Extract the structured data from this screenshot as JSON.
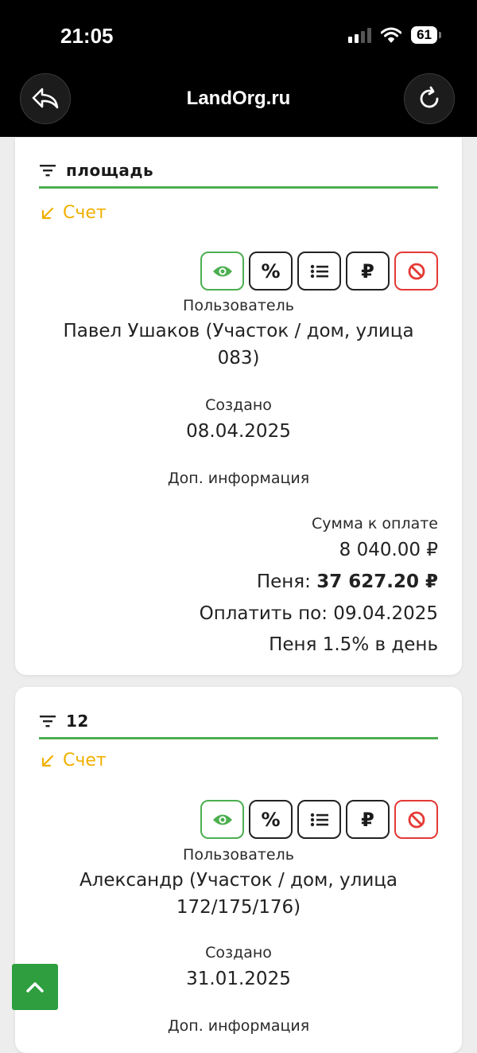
{
  "status_bar": {
    "time": "21:05",
    "battery": "61"
  },
  "header": {
    "title": "LandOrg.ru",
    "back_icon": "back-arrow-icon",
    "reload_icon": "reload-icon"
  },
  "invoices": [
    {
      "header_label": "площадь",
      "type_label": "Счет",
      "user_label": "Пользователь",
      "user_line1": "Павел Ушаков (Участок / дом, улица",
      "user_line2": "083)",
      "created_label": "Создано",
      "created_value": "08.04.2025",
      "extra_info_label": "Доп. информация",
      "amount_label": "Сумма к оплате",
      "amount_value": "8 040.00 ₽",
      "penalty_label": "Пеня:",
      "penalty_value": "37 627.20 ₽",
      "due_text": "Оплатить по: 09.04.2025",
      "penalty_rate": "Пеня 1.5% в день"
    },
    {
      "header_label": "12",
      "type_label": "Счет",
      "user_label": "Пользователь",
      "user_line1": "Александр (Участок / дом, улица",
      "user_line2": "172/175/176)",
      "created_label": "Создано",
      "created_value": "31.01.2025",
      "extra_info_label": "Доп. информация"
    }
  ],
  "actions": {
    "percent": "%",
    "ruble": "₽"
  },
  "colors": {
    "accent_green": "#4caf50",
    "type_yellow": "#f0b000",
    "block_red": "#e53935",
    "scroll_button": "#2e9e3f"
  }
}
